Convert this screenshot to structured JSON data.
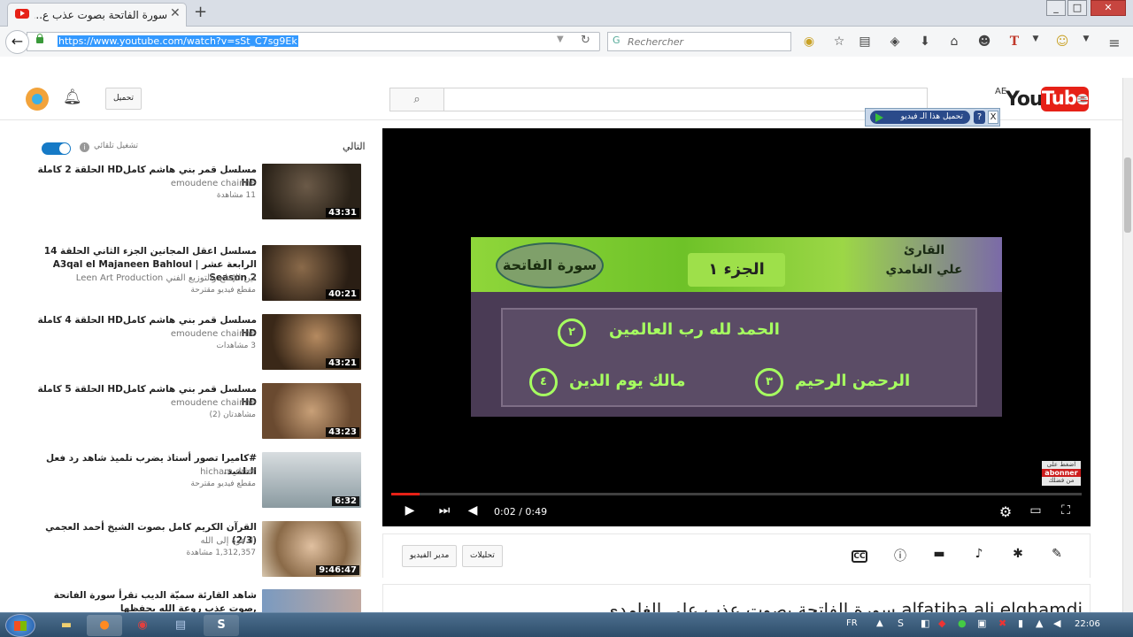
{
  "browser": {
    "tab_title": "سورة الفاتحة بصوت عذب ع...",
    "url": "https://www.youtube.com/watch?v=sSt_C7sg9Ek",
    "search_placeholder": "Rechercher",
    "new_tab": "+",
    "win_min": "_",
    "win_max": "□",
    "win_close": "✕"
  },
  "youtube": {
    "upload_label": "تحميل",
    "logo_prefix": "AE",
    "logo_you": "You",
    "logo_tube": "Tube",
    "download_helper": "تحميل هذا الـ فيديو",
    "download_help": "?",
    "download_close": "X"
  },
  "sidebar": {
    "up_next": "التالي",
    "autoplay": "تشغيل تلقائي",
    "videos": [
      {
        "title": "مسلسل قمر بني هاشم كاملHD الحلقة 2 كاملة HD",
        "channel": "emoudene chainne",
        "views": "11 مشاهدة",
        "duration": "43:31"
      },
      {
        "title": "مسلسل اعقل المجانين الجزء الثاني الحلقة 14 الرابعة عشر | A3qal el Majaneen Bahloul Season 2",
        "channel": "Leen Art Production لين للإنتاج والتوزيع الفني",
        "views": "مقطع فيديو مقترحة",
        "duration": "40:21"
      },
      {
        "title": "مسلسل قمر بني هاشم كاملHD الحلقة 4 كاملة HD",
        "channel": "emoudene chainne",
        "views": "3 مشاهدات",
        "duration": "43:21"
      },
      {
        "title": "مسلسل قمر بني هاشم كاملHD الحلقة 5 كاملة HD",
        "channel": "emoudene chainne",
        "views": "مشاهدتان (2)",
        "duration": "43:23"
      },
      {
        "title": "#كاميرا تصور أستاذ يضرب تلميذ شاهد رد فعل التلميذ.",
        "channel": "hicham drief",
        "views": "مقطع فيديو مقترحة",
        "duration": "6:32"
      },
      {
        "title": "القرآن الكريم كامل بصوت الشيخ أحمد العجمي (2/3)",
        "channel": "الدعوة إلى الله",
        "views": "1,312,357 مشاهدة",
        "duration": "9:46:47"
      },
      {
        "title": "شاهد القارئة سميّة الديب تقرأ سورة الفاتحة ,صوت عذب روعة الله يحفظها",
        "channel": "",
        "views": "",
        "duration": ""
      }
    ]
  },
  "player": {
    "frame_surah": "سورة الفاتحة",
    "frame_part": "الجزء ١",
    "frame_reciter_1": "القارئ",
    "frame_reciter_2": "علي الغامدي",
    "verse_1": "الحمد لله رب العالمين",
    "verse_2": "الرحمن الرحيم",
    "verse_3": "مالك يوم الدين",
    "num_2": "٢",
    "num_3": "٣",
    "num_4": "٤",
    "subscribe_top": "اضغط على",
    "subscribe_mid": "abonner",
    "subscribe_bot": "من فضلك",
    "time": "0:02 / 0:49",
    "progress_fraction": 0.041
  },
  "actions": {
    "video_manager": "مدير الفيديو",
    "analytics": "تحليلات"
  },
  "description": {
    "title": "سورة الفاتحة بصوت عذب علي الغامدي alfatiha ali elghamdi"
  },
  "taskbar": {
    "lang": "FR",
    "clock": "22:06"
  }
}
